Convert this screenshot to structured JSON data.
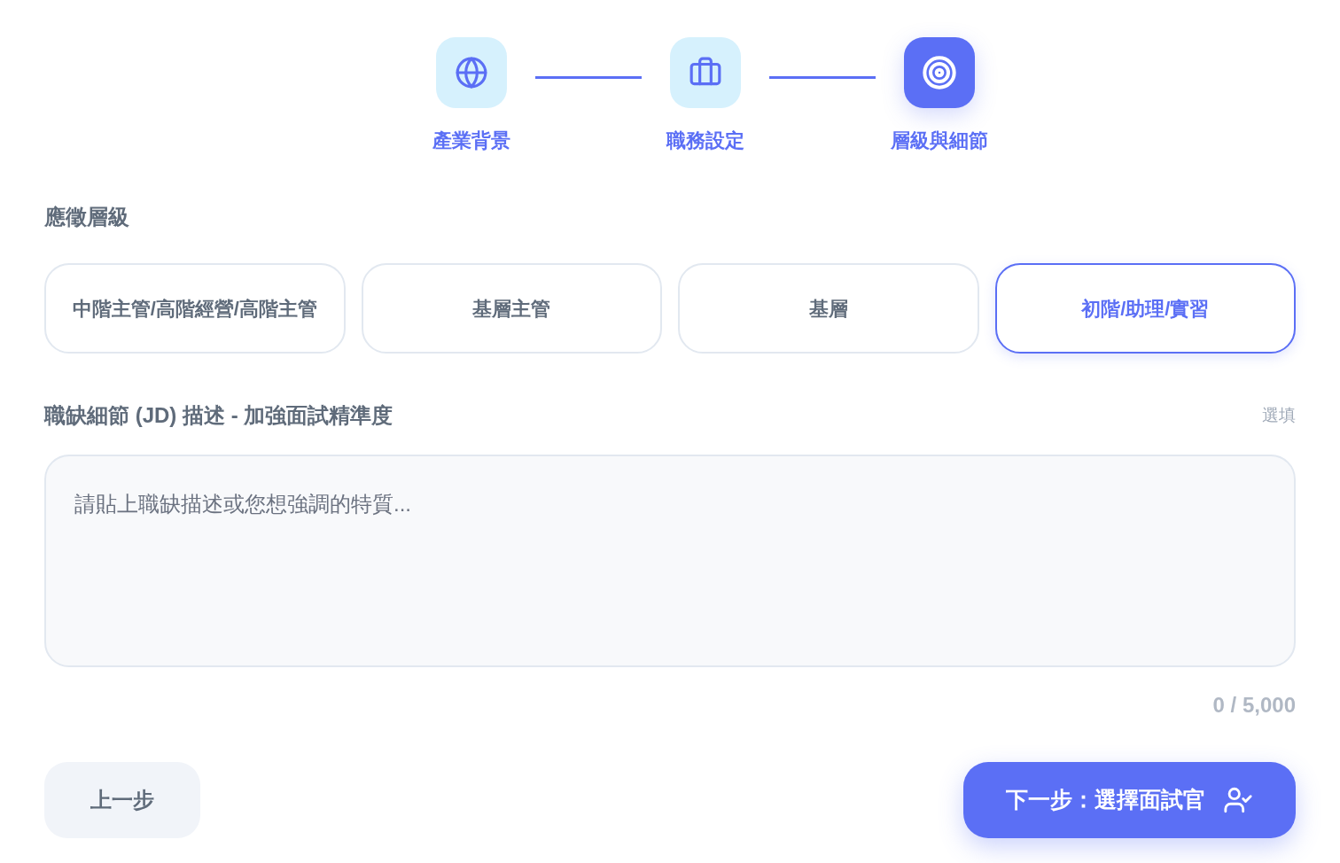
{
  "steps": [
    {
      "label": "產業背景",
      "selected": false
    },
    {
      "label": "職務設定",
      "selected": false
    },
    {
      "label": "層級與細節",
      "selected": true
    }
  ],
  "level_section": {
    "title": "應徵層級",
    "options": [
      {
        "label": "中階主管/高階經營/高階主管",
        "selected": false
      },
      {
        "label": "基層主管",
        "selected": false
      },
      {
        "label": "基層",
        "selected": false
      },
      {
        "label": "初階/助理/實習",
        "selected": true
      }
    ]
  },
  "jd_section": {
    "title": "職缺細節 (JD) 描述 - 加強面試精準度",
    "optional": "選填",
    "placeholder": "請貼上職缺描述或您想強調的特質...",
    "counter": "0 / 5,000"
  },
  "buttons": {
    "back": "上一步",
    "next": "下一步：選擇面試官"
  }
}
